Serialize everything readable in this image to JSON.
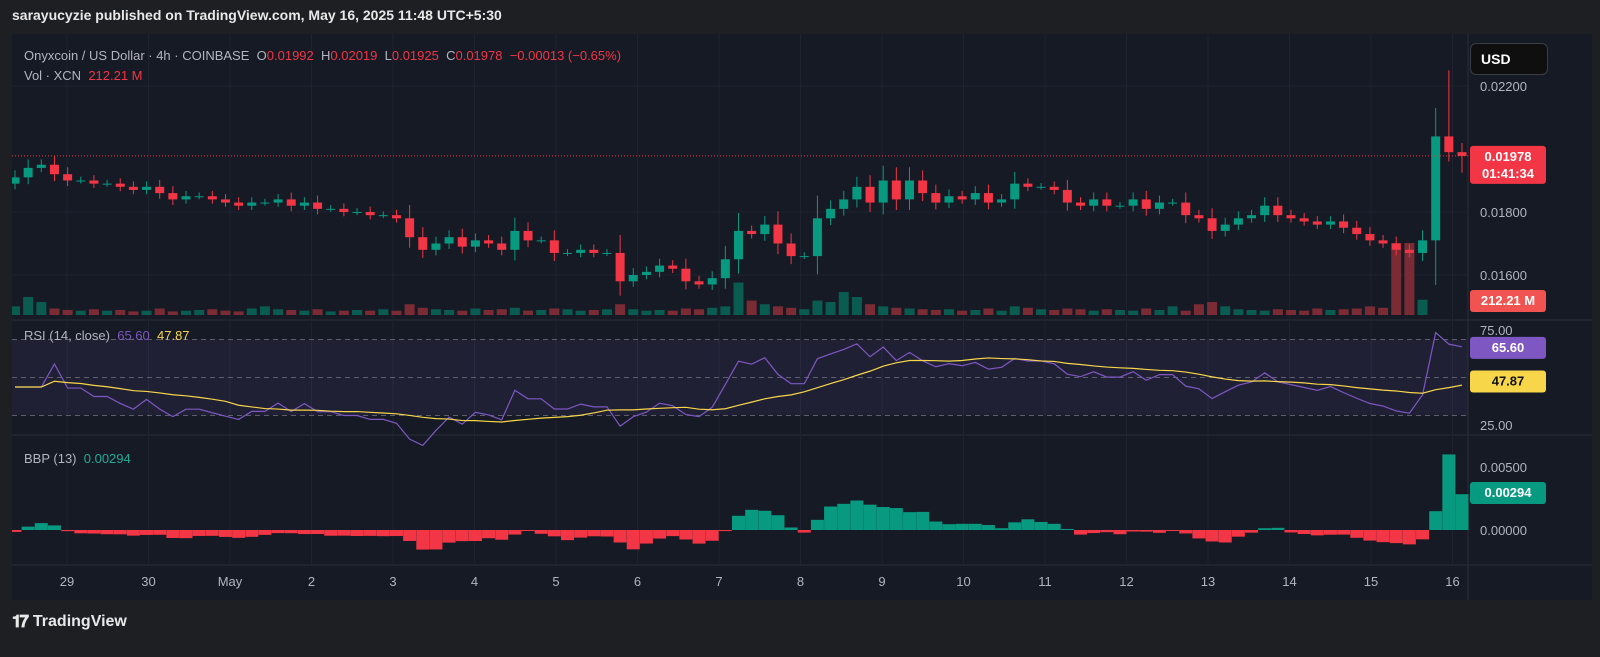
{
  "header": {
    "published": "sarayucyzie published on TradingView.com, May 16, 2025 11:48 UTC+5:30"
  },
  "legend": {
    "symbol": "Onyxcoin / US Dollar · 4h · COINBASE",
    "o_label": "O",
    "o": "0.01992",
    "h_label": "H",
    "h": "0.02019",
    "l_label": "L",
    "l": "0.01925",
    "c_label": "C",
    "c": "0.01978",
    "change": "−0.00013 (−0.65%)",
    "vol_label": "Vol · XCN",
    "vol": "212.21 M",
    "rsi_label": "RSI (14, close)",
    "rsi": "65.60",
    "rsi_ma": "47.87",
    "bbp_label": "BBP (13)",
    "bbp": "0.00294"
  },
  "currency_button": "USD",
  "price_tags": {
    "last": "0.01978",
    "countdown": "01:41:34",
    "volume": "212.21 M",
    "rsi": "65.60",
    "rsi_ma": "47.87",
    "bbp": "0.00294"
  },
  "footer": {
    "brand": "TradingView",
    "logo_mark": "17"
  },
  "colors": {
    "up": "#089981",
    "down": "#f23645",
    "rsi": "#7e57c2",
    "rsi_ma": "#f7d64a"
  },
  "chart_data": {
    "type": "candlestick",
    "interval": "4h",
    "price_ticks": [
      "0.02200",
      "0.01800",
      "0.01600"
    ],
    "price_tick_values": [
      0.022,
      0.018,
      0.016
    ],
    "rsi_ticks": [
      "75.00",
      "25.00"
    ],
    "bbp_ticks": [
      "0.00500",
      "0.00000"
    ],
    "x_labels": [
      "29",
      "30",
      "May",
      "2",
      "3",
      "4",
      "5",
      "6",
      "7",
      "8",
      "9",
      "10",
      "11",
      "12",
      "13",
      "14",
      "15",
      "16"
    ],
    "first_open": 0.0189,
    "closes": [
      0.0191,
      0.0194,
      0.0195,
      0.0192,
      0.019,
      0.019,
      0.0189,
      0.0189,
      0.0188,
      0.0187,
      0.0188,
      0.0186,
      0.0184,
      0.0185,
      0.0185,
      0.0184,
      0.0183,
      0.0182,
      0.0183,
      0.0183,
      0.0184,
      0.0182,
      0.0183,
      0.0181,
      0.0181,
      0.018,
      0.018,
      0.0179,
      0.0179,
      0.0178,
      0.0172,
      0.0168,
      0.017,
      0.0172,
      0.0169,
      0.0171,
      0.017,
      0.0168,
      0.0174,
      0.0171,
      0.0171,
      0.0167,
      0.0167,
      0.0168,
      0.0167,
      0.0167,
      0.0158,
      0.016,
      0.0161,
      0.0163,
      0.0162,
      0.0158,
      0.0157,
      0.0159,
      0.0165,
      0.0174,
      0.0173,
      0.0176,
      0.017,
      0.0166,
      0.0166,
      0.0178,
      0.0181,
      0.0184,
      0.0188,
      0.0183,
      0.019,
      0.0184,
      0.019,
      0.0186,
      0.0183,
      0.0185,
      0.0184,
      0.0186,
      0.0183,
      0.0184,
      0.0189,
      0.0188,
      0.0188,
      0.0187,
      0.0183,
      0.0182,
      0.0184,
      0.0182,
      0.0182,
      0.0184,
      0.0181,
      0.0183,
      0.0183,
      0.0179,
      0.0178,
      0.0174,
      0.0176,
      0.0178,
      0.0179,
      0.0182,
      0.0179,
      0.0178,
      0.0177,
      0.0176,
      0.0177,
      0.0175,
      0.0173,
      0.0171,
      0.017,
      0.0168,
      0.0167,
      0.0171,
      0.0204,
      0.0199,
      0.01978
    ],
    "volumes_m": [
      120,
      250,
      180,
      90,
      70,
      60,
      80,
      60,
      70,
      50,
      60,
      90,
      50,
      60,
      70,
      80,
      60,
      50,
      90,
      120,
      80,
      70,
      60,
      80,
      50,
      60,
      70,
      60,
      80,
      60,
      150,
      100,
      80,
      70,
      60,
      90,
      70,
      80,
      100,
      60,
      70,
      90,
      80,
      60,
      70,
      80,
      150,
      80,
      60,
      70,
      60,
      90,
      80,
      100,
      120,
      450,
      200,
      150,
      120,
      100,
      80,
      200,
      180,
      320,
      250,
      150,
      120,
      100,
      90,
      80,
      70,
      80,
      60,
      70,
      90,
      60,
      120,
      100,
      80,
      70,
      90,
      80,
      60,
      80,
      70,
      60,
      90,
      70,
      120,
      60,
      150,
      180,
      120,
      80,
      70,
      60,
      80,
      70,
      60,
      90,
      70,
      80,
      90,
      120,
      100,
      1000,
      1000,
      212.21
    ],
    "rsi_last": 65.6,
    "rsi_ma_last": 47.87,
    "bbp_last": 0.00294
  }
}
